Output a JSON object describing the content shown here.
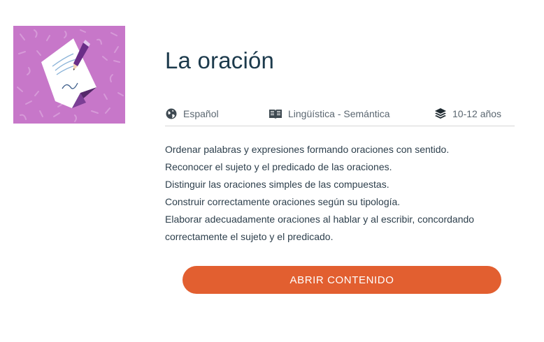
{
  "resource": {
    "title": "La oración",
    "thumbnail_icon": "paper-and-pencil-icon",
    "thumbnail_bg": "#c777c9"
  },
  "meta": {
    "language": {
      "icon": "globe-icon",
      "label": "Español"
    },
    "subject": {
      "icon": "book-icon",
      "label": "Lingüística - Semántica"
    },
    "age": {
      "icon": "layers-icon",
      "label": "10-12 años"
    }
  },
  "objectives": [
    "Ordenar palabras y expresiones formando oraciones con sentido.",
    "Reconocer el sujeto y el predicado de las oraciones.",
    "Distinguir las oraciones simples de las compuestas.",
    "Construir correctamente oraciones según su tipología.",
    "Elaborar adecuadamente oraciones al hablar y al escribir, concordando",
    "correctamente el sujeto y el predicado."
  ],
  "action": {
    "open_label": "ABRIR CONTENIDO"
  },
  "colors": {
    "title": "#1c3a4c",
    "button": "#e25f30",
    "thumbnail": "#c777c9"
  }
}
